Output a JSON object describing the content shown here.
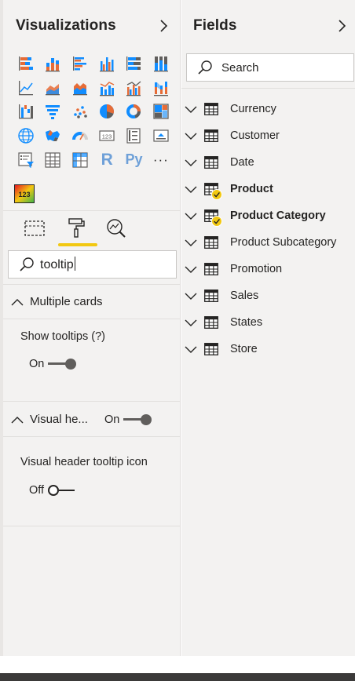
{
  "visualizations": {
    "title": "Visualizations",
    "search": {
      "value": "tooltip"
    },
    "sections": {
      "multiple_cards": {
        "label": "Multiple cards"
      },
      "show_tooltips": {
        "label": "Show tooltips (?)",
        "state_label": "On"
      },
      "visual_header": {
        "label": "Visual he...",
        "state_label": "On"
      },
      "visual_header_tooltip_icon": {
        "label": "Visual header tooltip icon",
        "state_label": "Off"
      }
    },
    "icon_grid": [
      [
        "stacked-bar-chart-icon",
        "stacked-column-chart-icon",
        "clustered-bar-chart-icon",
        "clustered-column-chart-icon",
        "100-stacked-bar-chart-icon",
        "100-stacked-column-chart-icon"
      ],
      [
        "line-chart-icon",
        "area-chart-icon",
        "stacked-area-chart-icon",
        "line-and-stacked-column-chart-icon",
        "line-and-clustered-column-chart-icon",
        "ribbon-chart-icon"
      ],
      [
        "waterfall-chart-icon",
        "funnel-icon",
        "scatter-chart-icon",
        "pie-chart-icon",
        "donut-chart-icon",
        "treemap-icon"
      ],
      [
        "map-icon",
        "filled-map-icon",
        "gauge-icon",
        "card-icon",
        "multi-row-card-icon",
        "kpi-icon"
      ],
      [
        "slicer-icon",
        "table-icon",
        "matrix-icon",
        "r-visual-icon",
        "python-visual-icon",
        "more-visuals-icon"
      ]
    ],
    "r_label": "R",
    "py_label": "Py",
    "more_label": "···",
    "custom_visual_label": "123"
  },
  "fields": {
    "title": "Fields",
    "search_placeholder": "Search",
    "items": [
      {
        "label": "Currency",
        "bold": false,
        "checked": false
      },
      {
        "label": "Customer",
        "bold": false,
        "checked": false
      },
      {
        "label": "Date",
        "bold": false,
        "checked": false
      },
      {
        "label": "Product",
        "bold": true,
        "checked": true
      },
      {
        "label": "Product Category",
        "bold": true,
        "checked": true
      },
      {
        "label": "Product Subcategory",
        "bold": false,
        "checked": false
      },
      {
        "label": "Promotion",
        "bold": false,
        "checked": false
      },
      {
        "label": "Sales",
        "bold": false,
        "checked": false
      },
      {
        "label": "States",
        "bold": false,
        "checked": false
      },
      {
        "label": "Store",
        "bold": false,
        "checked": false
      }
    ]
  },
  "colors": {
    "pane_bg": "#f3f2f1",
    "accent_yellow": "#f2c811",
    "icon_blue": "#118dff",
    "icon_orange": "#e66c37",
    "icon_gray": "#605e5c"
  }
}
